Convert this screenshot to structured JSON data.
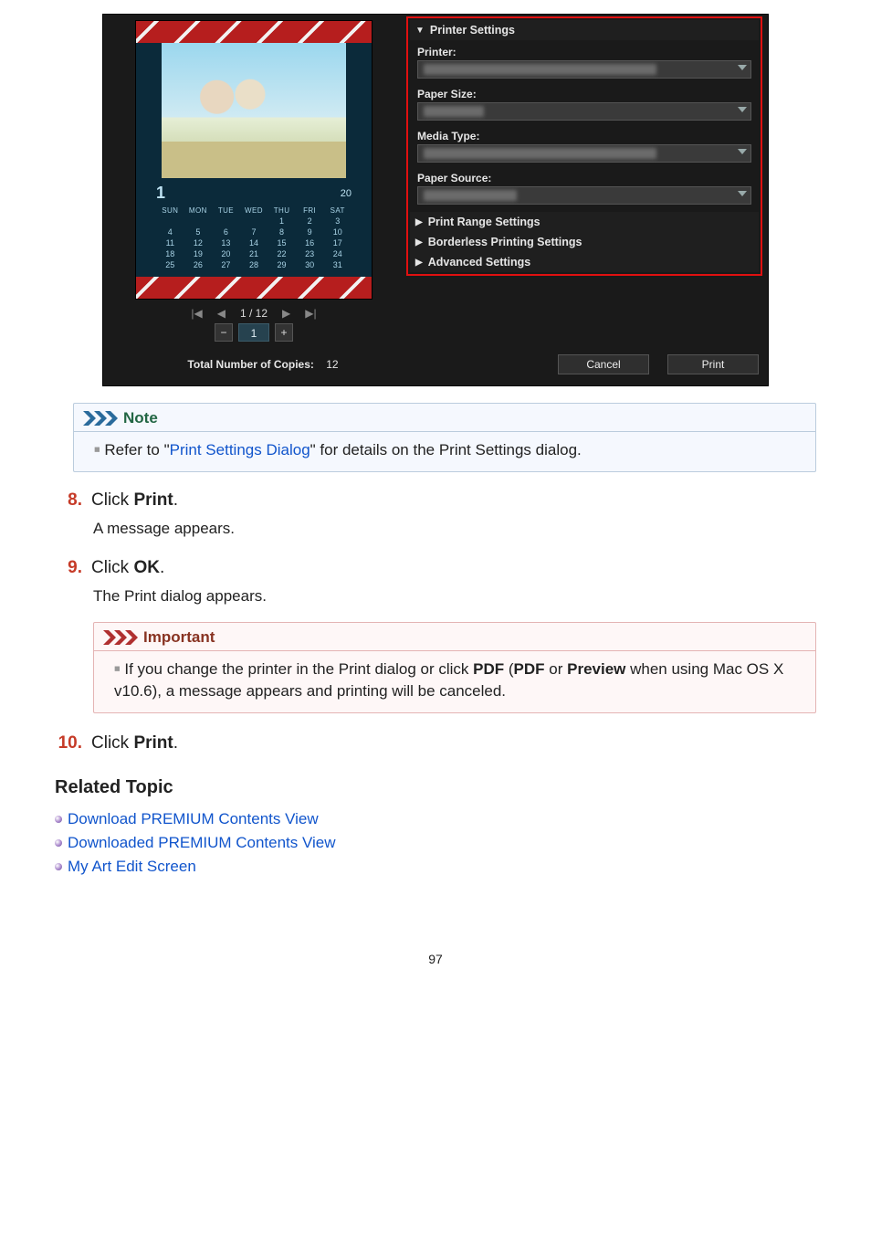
{
  "dialog": {
    "printer_settings_title": "Printer Settings",
    "printer_label": "Printer:",
    "paper_size_label": "Paper Size:",
    "media_type_label": "Media Type:",
    "paper_source_label": "Paper Source:",
    "print_range_title": "Print Range Settings",
    "borderless_title": "Borderless Printing Settings",
    "advanced_title": "Advanced Settings",
    "page_counter": "1 / 12",
    "copies_value": "1",
    "total_copies_label": "Total Number of Copies:",
    "total_copies_value": "12",
    "cancel": "Cancel",
    "print": "Print",
    "calendar": {
      "month": "1",
      "year": "20",
      "dow": [
        "SUN",
        "MON",
        "TUE",
        "WED",
        "THU",
        "FRI",
        "SAT"
      ],
      "rows": [
        [
          "",
          "",
          "",
          "",
          "1",
          "2",
          "3"
        ],
        [
          "4",
          "5",
          "6",
          "7",
          "8",
          "9",
          "10"
        ],
        [
          "11",
          "12",
          "13",
          "14",
          "15",
          "16",
          "17"
        ],
        [
          "18",
          "19",
          "20",
          "21",
          "22",
          "23",
          "24"
        ],
        [
          "25",
          "26",
          "27",
          "28",
          "29",
          "30",
          "31"
        ]
      ]
    }
  },
  "note": {
    "heading": "Note",
    "pre": "Refer to \"",
    "link": "Print Settings Dialog",
    "post": "\" for details on the Print Settings dialog."
  },
  "steps": {
    "s8_num": "8.",
    "s8_text_a": "Click ",
    "s8_text_b": "Print",
    "s8_text_c": ".",
    "s8_sub": "A message appears.",
    "s9_num": "9.",
    "s9_text_a": "Click ",
    "s9_text_b": "OK",
    "s9_text_c": ".",
    "s9_sub": "The Print dialog appears.",
    "s10_num": "10.",
    "s10_text_a": "Click ",
    "s10_text_b": "Print",
    "s10_text_c": "."
  },
  "important": {
    "heading": "Important",
    "t1": "If you change the printer in the Print dialog or click ",
    "t2": "PDF",
    "t3": " (",
    "t4": "PDF",
    "t5": " or ",
    "t6": "Preview",
    "t7": " when using Mac OS X v10.6), a message appears and printing will be canceled."
  },
  "related": {
    "heading": "Related Topic",
    "l1": "Download PREMIUM Contents View",
    "l2": "Downloaded PREMIUM Contents View",
    "l3": "My Art Edit Screen"
  },
  "page_number": "97"
}
